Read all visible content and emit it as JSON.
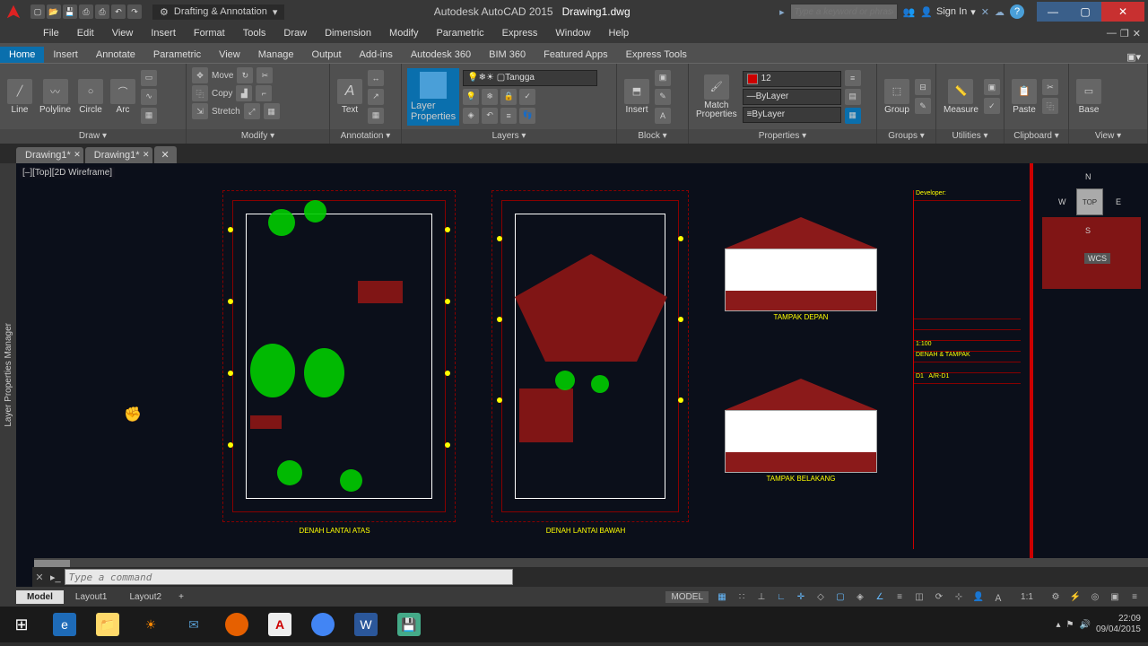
{
  "titlebar": {
    "workspace": "Drafting & Annotation",
    "app_name": "Autodesk AutoCAD 2015",
    "file_name": "Drawing1.dwg",
    "search_placeholder": "Type a keyword or phrase",
    "signin": "Sign In"
  },
  "menubar": [
    "File",
    "Edit",
    "View",
    "Insert",
    "Format",
    "Tools",
    "Draw",
    "Dimension",
    "Modify",
    "Parametric",
    "Express",
    "Window",
    "Help"
  ],
  "ribbon_tabs": [
    "Home",
    "Insert",
    "Annotate",
    "Parametric",
    "View",
    "Manage",
    "Output",
    "Add-ins",
    "Autodesk 360",
    "BIM 360",
    "Featured Apps",
    "Express Tools"
  ],
  "ribbon": {
    "draw": {
      "title": "Draw",
      "btns": [
        "Line",
        "Polyline",
        "Circle",
        "Arc"
      ]
    },
    "modify": {
      "title": "Modify",
      "rows": [
        "Move",
        "Copy",
        "Stretch"
      ]
    },
    "annotation": {
      "title": "Annotation",
      "text": "Text"
    },
    "layers": {
      "title": "Layers",
      "prop_btn": "Layer\nProperties",
      "current": "Tangga"
    },
    "block": {
      "title": "Block",
      "insert": "Insert"
    },
    "properties": {
      "title": "Properties",
      "match": "Match\nProperties",
      "color": "12",
      "lt": "ByLayer",
      "lw": "ByLayer"
    },
    "groups": {
      "title": "Groups",
      "btn": "Group"
    },
    "utilities": {
      "title": "Utilities",
      "btn": "Measure"
    },
    "clipboard": {
      "title": "Clipboard",
      "btn": "Paste"
    },
    "view": {
      "title": "View",
      "btn": "Base"
    }
  },
  "file_tabs": [
    "Drawing1*",
    "Drawing1*"
  ],
  "side_panel": "Layer Properties Manager",
  "view_label": "[–][Top][2D Wireframe]",
  "plan_labels": {
    "p1": "DENAH LANTAI ATAS",
    "p2": "DENAH LANTAI BAWAH"
  },
  "elev_labels": {
    "e1": "TAMPAK DEPAN",
    "e2": "TAMPAK BELAKANG"
  },
  "titleblock": {
    "dev": "Developer:",
    "scale": "1:100",
    "sheet": "DENAH & TAMPAK",
    "code1": "D1",
    "code2": "A/R-D1"
  },
  "viewcube": {
    "n": "N",
    "s": "S",
    "e": "E",
    "w": "W",
    "face": "TOP",
    "wcs": "WCS"
  },
  "cmdline": {
    "placeholder": "Type a command"
  },
  "layout_tabs": [
    "Model",
    "Layout1",
    "Layout2"
  ],
  "statusbar": {
    "model": "MODEL",
    "scale": "1:1"
  },
  "taskbar": {
    "time": "22:09",
    "date": "09/04/2015"
  }
}
